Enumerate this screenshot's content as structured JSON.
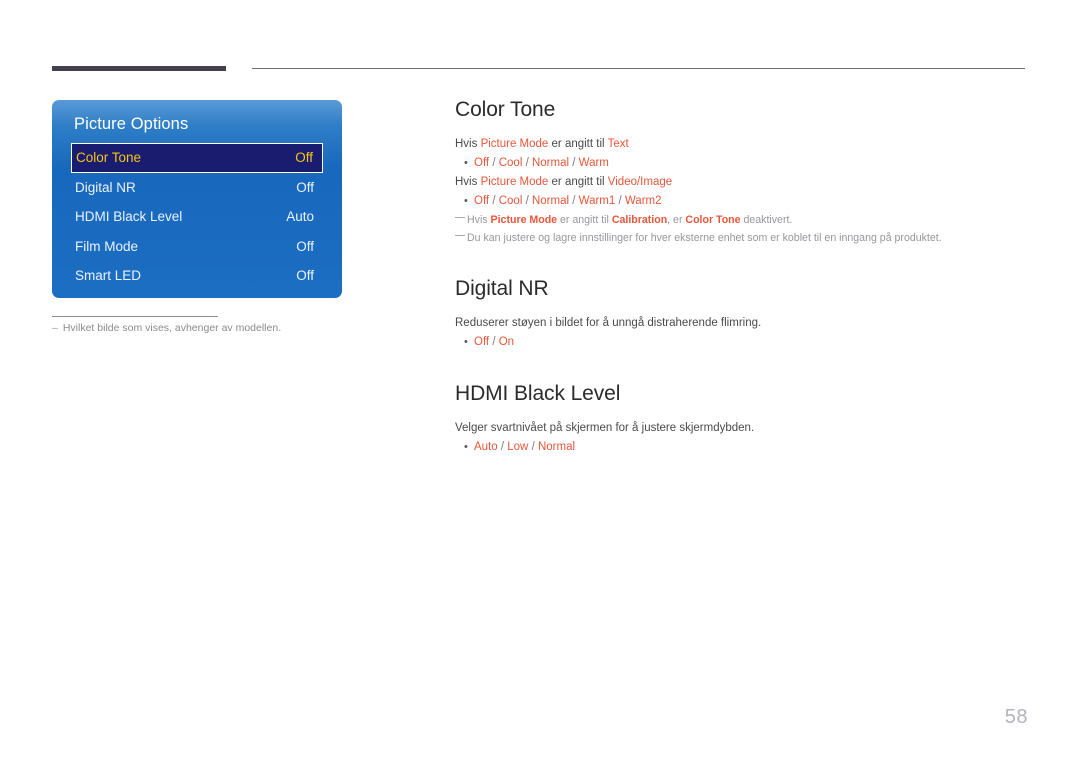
{
  "page": {
    "number": "58"
  },
  "osd": {
    "title": "Picture Options",
    "rows": [
      {
        "label": "Color Tone",
        "value": "Off",
        "selected": true
      },
      {
        "label": "Digital NR",
        "value": "Off",
        "selected": false
      },
      {
        "label": "HDMI Black Level",
        "value": "Auto",
        "selected": false
      },
      {
        "label": "Film Mode",
        "value": "Off",
        "selected": false
      },
      {
        "label": "Smart LED",
        "value": "Off",
        "selected": false
      }
    ],
    "footnote_dash": "‒",
    "footnote": "Hvilket bilde som vises, avhenger av modellen."
  },
  "sections": {
    "color_tone": {
      "heading": "Color Tone",
      "line1_a": "Hvis ",
      "line1_b": "Picture Mode",
      "line1_c": " er angitt til ",
      "line1_d": "Text",
      "bullet1": "Off / Cool / Normal / Warm",
      "line2_a": "Hvis ",
      "line2_b": "Picture Mode",
      "line2_c": " er angitt til ",
      "line2_d": "Video/Image",
      "bullet2": "Off / Cool / Normal / Warm1 / Warm2",
      "note1_a": "Hvis ",
      "note1_b": "Picture Mode",
      "note1_c": " er angitt til ",
      "note1_d": "Calibration",
      "note1_e": ", er ",
      "note1_f": "Color Tone",
      "note1_g": " deaktivert.",
      "note2": "Du kan justere og lagre innstillinger for hver eksterne enhet som er koblet til en inngang på produktet."
    },
    "digital_nr": {
      "heading": "Digital NR",
      "desc": "Reduserer støyen i bildet for å unngå distraherende flimring.",
      "bullet": "Off / On"
    },
    "hdmi_black_level": {
      "heading": "HDMI Black Level",
      "desc": "Velger svartnivået på skjermen for å justere skjermdybden.",
      "bullet": "Auto / Low / Normal"
    }
  },
  "colors": {
    "accent": "#e8563a",
    "osd_blue": "#1868bd",
    "osd_selected_bg": "#1a1c70",
    "osd_selected_text": "#f5c518",
    "rule_dark": "#433f4d"
  }
}
